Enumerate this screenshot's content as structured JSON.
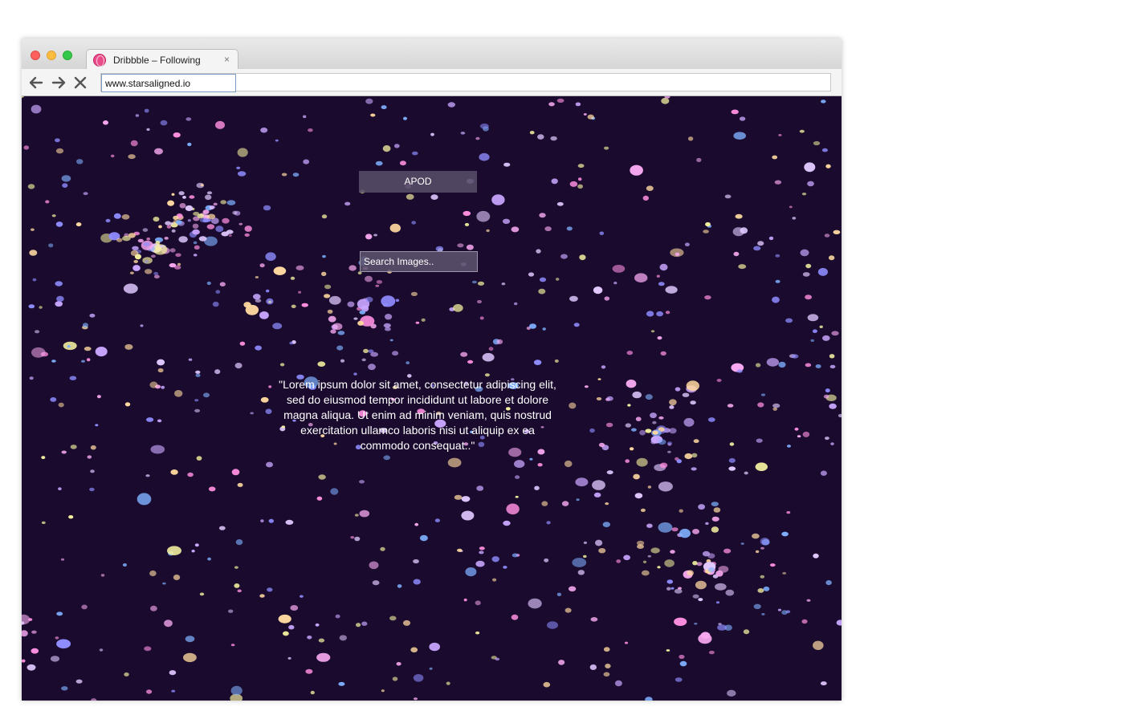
{
  "browser": {
    "tab_title": "Dribbble – Following",
    "tab_close": "×",
    "url": "www.starsaligned.io"
  },
  "page": {
    "apod_label": "APOD",
    "search_placeholder": "Search Images..",
    "quote": "\"Lorem ipsum dolor sit amet, consectetur adipiscing elit, sed do eiusmod tempor incididunt ut labore et dolore magna aliqua. Ut enim ad minim veniam, quis nostrud exercitation ullamco laboris nisi ut aliquip ex ea commodo consequat..\""
  },
  "colors": {
    "background": "#1a0b2e",
    "star_palette": [
      "#f7a8f0",
      "#c9a6ff",
      "#8f8cff",
      "#ffd9a0",
      "#f6f2a0",
      "#ff8fe0",
      "#e0c8ff",
      "#7fb0ff"
    ]
  },
  "icons": {
    "back": "arrow-left-icon",
    "forward": "arrow-right-icon",
    "stop": "close-icon",
    "favicon": "dribbble-icon"
  }
}
